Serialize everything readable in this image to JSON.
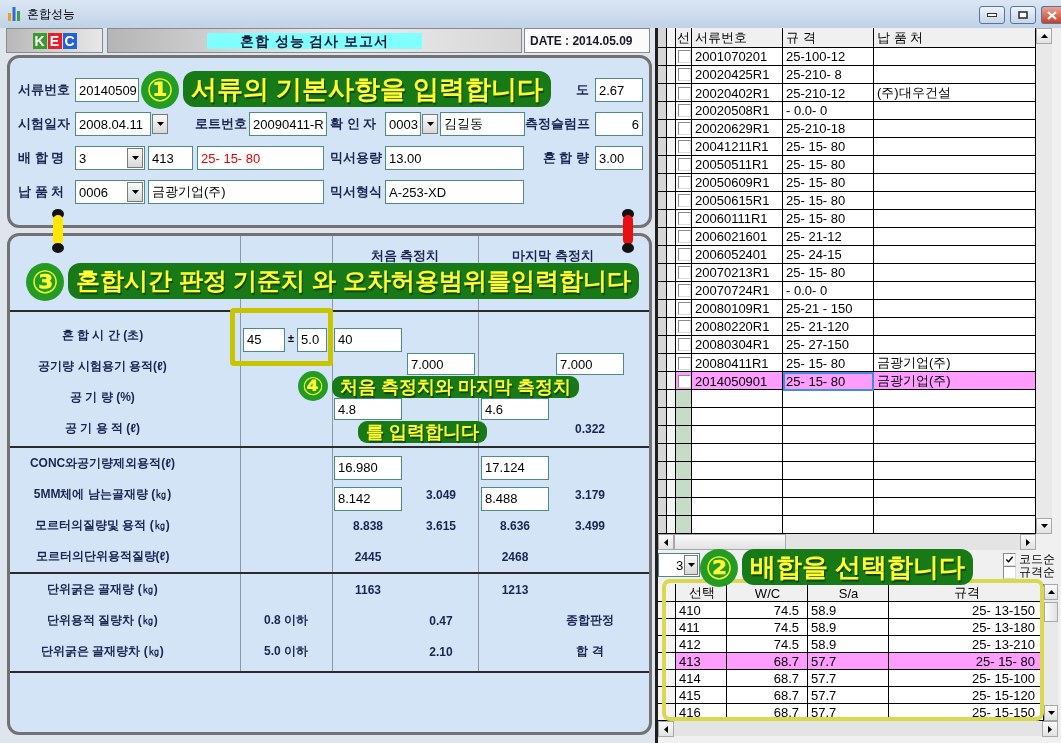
{
  "window": {
    "title": "혼합성능"
  },
  "header": {
    "logo": [
      {
        "letter": "K",
        "color": "#3c9a2c"
      },
      {
        "letter": "E",
        "color": "#e3202a"
      },
      {
        "letter": "C",
        "color": "#2463d6"
      }
    ],
    "report_title": "혼합 성능 검사 보고서",
    "date": "DATE : 2014.05.09"
  },
  "form": {
    "doc_no": {
      "label": "서류번호",
      "value": "20140509"
    },
    "density": {
      "label": "도",
      "value": "2.67"
    },
    "test_date": {
      "label": "시험일자",
      "value": "2008.04.11"
    },
    "lot_no": {
      "label": "로트번호",
      "value": "20090411-R"
    },
    "checker": {
      "label": "확 인 자",
      "code": "0003",
      "name": "김길동"
    },
    "slump": {
      "label": "측정슬럼프",
      "value": "6"
    },
    "mix_name": {
      "label": "배 합 명",
      "code": "3",
      "mix_no": "413",
      "spec": "25- 15- 80"
    },
    "mixer_capacity": {
      "label": "믹서용량",
      "value": "13.00"
    },
    "mix_amount": {
      "label": "혼 합 량",
      "value": "3.00"
    },
    "supplier": {
      "label": "납 품 처",
      "code": "0006",
      "name": "금광기업(주)"
    },
    "mixer_type": {
      "label": "믹서형식",
      "value": "A-253-XD"
    }
  },
  "report": {
    "columns": [
      "처음 측정치",
      "마지막 측정치"
    ],
    "groups": [
      [
        {
          "label": "혼 합 시 간 (초)",
          "standard": {
            "kind": "tolerance",
            "value": "45",
            "sign": "±",
            "tolerance": "5.0"
          },
          "first": {
            "left": {
              "kind": "input",
              "value": "40"
            }
          }
        },
        {
          "label": "공기량 시험용기 용적(ℓ)",
          "first": {
            "right": {
              "kind": "input",
              "value": "7.000"
            }
          },
          "last": {
            "right": {
              "kind": "input",
              "value": "7.000"
            }
          }
        },
        {
          "label": "공 기 량 (%)",
          "first": {
            "left": {
              "kind": "input",
              "value": "4.8"
            }
          },
          "last": {
            "left": {
              "kind": "input",
              "value": "4.6"
            }
          }
        },
        {
          "label": "공 기 용 적 (ℓ)",
          "last": {
            "right": {
              "kind": "value",
              "text": "0.322"
            }
          }
        }
      ],
      [
        {
          "label": "CONC와공기량제외용적(ℓ)",
          "first": {
            "left": {
              "kind": "input",
              "value": "16.980"
            }
          },
          "last": {
            "left": {
              "kind": "input",
              "value": "17.124"
            }
          }
        },
        {
          "label": "5MM체에 남는골재량 (㎏)",
          "first": {
            "left": {
              "kind": "input",
              "value": "8.142"
            },
            "right": {
              "kind": "value",
              "text": "3.049"
            }
          },
          "last": {
            "left": {
              "kind": "input",
              "value": "8.488"
            },
            "right": {
              "kind": "value",
              "text": "3.179"
            }
          }
        },
        {
          "label": "모르터의질량및 용적 (㎏)",
          "first": {
            "left": {
              "kind": "value",
              "text": "8.838"
            },
            "right": {
              "kind": "value",
              "text": "3.615"
            }
          },
          "last": {
            "left": {
              "kind": "value",
              "text": "8.636"
            },
            "right": {
              "kind": "value",
              "text": "3.499"
            }
          }
        },
        {
          "label": "모르터의단위용적질량(ℓ)",
          "first": {
            "left": {
              "kind": "value",
              "text": "2445"
            }
          },
          "last": {
            "left": {
              "kind": "value",
              "text": "2468"
            }
          }
        }
      ],
      [
        {
          "label": "단위굵은 골재량 (㎏)",
          "first": {
            "left": {
              "kind": "value",
              "text": "1163"
            }
          },
          "last": {
            "left": {
              "kind": "value",
              "text": "1213"
            }
          }
        },
        {
          "label": "단위용적 질량차 (㎏)",
          "standard": {
            "kind": "value",
            "text": "0.8 이하"
          },
          "first": {
            "right": {
              "kind": "value",
              "text": "0.47"
            }
          },
          "last": {
            "right": {
              "kind": "value",
              "text": "종합판정"
            }
          }
        },
        {
          "label": "단위굵은 골재량차 (㎏)",
          "standard": {
            "kind": "value",
            "text": "5.0 이하"
          },
          "first": {
            "right": {
              "kind": "value",
              "text": "2.10"
            }
          },
          "last": {
            "right": {
              "kind": "value",
              "text": "합 격"
            }
          }
        }
      ]
    ]
  },
  "documents": {
    "columns": [
      "선",
      "서류번호",
      "규 격",
      "납 품 처"
    ],
    "rows": [
      {
        "doc_no": "2001070201",
        "spec": "25-100-12",
        "checked": false,
        "selected": false,
        "focused": false
      },
      {
        "doc_no": "20020425R1",
        "spec": "25-210- 8",
        "checked": false,
        "selected": false,
        "focused": false
      },
      {
        "doc_no": "20020402R1",
        "spec": "25-210-12",
        "supplier": "(주)대우건설",
        "checked": false,
        "selected": false,
        "focused": false
      },
      {
        "doc_no": "20020508R1",
        "spec": "- 0.0- 0",
        "checked": false,
        "selected": false,
        "focused": false
      },
      {
        "doc_no": "20020629R1",
        "spec": "25-210-18",
        "checked": false,
        "selected": false,
        "focused": false
      },
      {
        "doc_no": "20041211R1",
        "spec": "25- 15- 80",
        "checked": false,
        "selected": false,
        "focused": false
      },
      {
        "doc_no": "20050511R1",
        "spec": "25- 15- 80",
        "checked": false,
        "selected": false,
        "focused": false
      },
      {
        "doc_no": "20050609R1",
        "spec": "25- 15- 80",
        "checked": false,
        "selected": false,
        "focused": false
      },
      {
        "doc_no": "20050615R1",
        "spec": "25- 15- 80",
        "checked": false,
        "selected": false,
        "focused": false
      },
      {
        "doc_no": "20060111R1",
        "spec": "25- 15- 80",
        "checked": false,
        "selected": false,
        "focused": false
      },
      {
        "doc_no": "2006021601",
        "spec": "25- 21-12",
        "checked": false,
        "selected": false,
        "focused": false
      },
      {
        "doc_no": "2006052401",
        "spec": "25- 24-15",
        "checked": false,
        "selected": false,
        "focused": false
      },
      {
        "doc_no": "20070213R1",
        "spec": "25- 15- 80",
        "checked": false,
        "selected": false,
        "focused": false
      },
      {
        "doc_no": "20070724R1",
        "spec": "- 0.0- 0",
        "checked": false,
        "selected": false,
        "focused": false
      },
      {
        "doc_no": "20080109R1",
        "spec": "25-21 - 150",
        "checked": false,
        "selected": false,
        "focused": false
      },
      {
        "doc_no": "20080220R1",
        "spec": "25- 21-120",
        "checked": false,
        "selected": false,
        "focused": false
      },
      {
        "doc_no": "20080304R1",
        "spec": "25- 27-150",
        "checked": false,
        "selected": false,
        "focused": false
      },
      {
        "doc_no": "20080411R1",
        "spec": "25- 15- 80",
        "supplier": "금광기업(주)",
        "checked": false,
        "selected": false,
        "focused": false
      },
      {
        "doc_no": "2014050901",
        "spec": "25- 15- 80",
        "supplier": "금광기업(주)",
        "checked": false,
        "selected": true,
        "focused": true
      }
    ]
  },
  "mix_picker": {
    "code": "3",
    "sort_options": [
      {
        "label": "코드순",
        "checked": true
      },
      {
        "label": "규격순",
        "checked": false
      }
    ]
  },
  "mix_table": {
    "columns": [
      "선택",
      "W/C",
      "S/a",
      "규격"
    ],
    "rows": [
      {
        "no": "410",
        "wc": "74.5",
        "sa": "58.9",
        "spec": "25- 13-150",
        "selected": false
      },
      {
        "no": "411",
        "wc": "74.5",
        "sa": "58.9",
        "spec": "25- 13-180",
        "selected": false
      },
      {
        "no": "412",
        "wc": "74.5",
        "sa": "58.9",
        "spec": "25- 13-210",
        "selected": false
      },
      {
        "no": "413",
        "wc": "68.7",
        "sa": "57.7",
        "spec": "25- 15- 80",
        "selected": true
      },
      {
        "no": "414",
        "wc": "68.7",
        "sa": "57.7",
        "spec": "25- 15-100",
        "selected": false
      },
      {
        "no": "415",
        "wc": "68.7",
        "sa": "57.7",
        "spec": "25- 15-120",
        "selected": false
      },
      {
        "no": "416",
        "wc": "68.7",
        "sa": "57.7",
        "spec": "25- 15-150",
        "selected": false
      }
    ]
  },
  "callouts": [
    {
      "number": "①",
      "lines": [
        "서류의 기본사항을 입력합니다"
      ]
    },
    {
      "number": "③",
      "lines": [
        "혼합시간 판정 기준치 와 오차허용범위를입력합니다"
      ]
    },
    {
      "number": "④",
      "lines": [
        "처음 측정치와 마지막 측정치",
        "를 입력합니다"
      ]
    },
    {
      "number": "②",
      "lines": [
        "배합을 선택합니다"
      ]
    }
  ]
}
